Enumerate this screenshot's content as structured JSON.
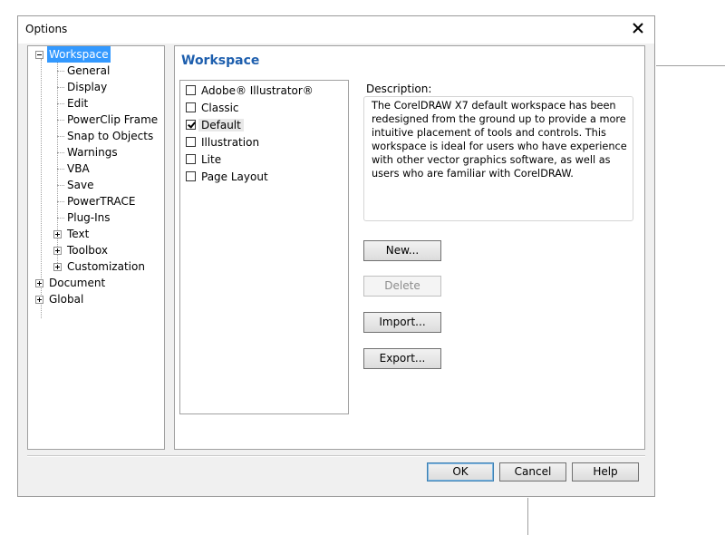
{
  "dialog": {
    "title": "Options",
    "close_icon": "close-icon"
  },
  "tree": {
    "items": [
      {
        "label": "Workspace",
        "selected": true,
        "expander": "minus"
      },
      {
        "label": "General"
      },
      {
        "label": "Display"
      },
      {
        "label": "Edit"
      },
      {
        "label": "PowerClip Frame"
      },
      {
        "label": "Snap to Objects"
      },
      {
        "label": "Warnings"
      },
      {
        "label": "VBA"
      },
      {
        "label": "Save"
      },
      {
        "label": "PowerTRACE"
      },
      {
        "label": "Plug-Ins"
      },
      {
        "label": "Text",
        "expander": "plus"
      },
      {
        "label": "Toolbox",
        "expander": "plus"
      },
      {
        "label": "Customization",
        "expander": "plus"
      },
      {
        "label": "Document",
        "expander": "plus"
      },
      {
        "label": "Global",
        "expander": "plus"
      }
    ]
  },
  "content": {
    "heading": "Workspace",
    "workspaces": [
      {
        "label": "Adobe® Illustrator®",
        "checked": false
      },
      {
        "label": "Classic",
        "checked": false
      },
      {
        "label": "Default",
        "checked": true
      },
      {
        "label": "Illustration",
        "checked": false
      },
      {
        "label": "Lite",
        "checked": false
      },
      {
        "label": "Page Layout",
        "checked": false
      }
    ],
    "description_label": "Description:",
    "description_text": "The CorelDRAW X7 default workspace has been redesigned from the ground up to provide a more intuitive placement of tools and controls. This workspace is ideal for users who have experience with other vector graphics software, as well as users who are familiar with CorelDRAW.",
    "buttons": {
      "new": "New...",
      "delete": "Delete",
      "import": "Import...",
      "export": "Export..."
    }
  },
  "footer": {
    "ok": "OK",
    "cancel": "Cancel",
    "help": "Help"
  }
}
